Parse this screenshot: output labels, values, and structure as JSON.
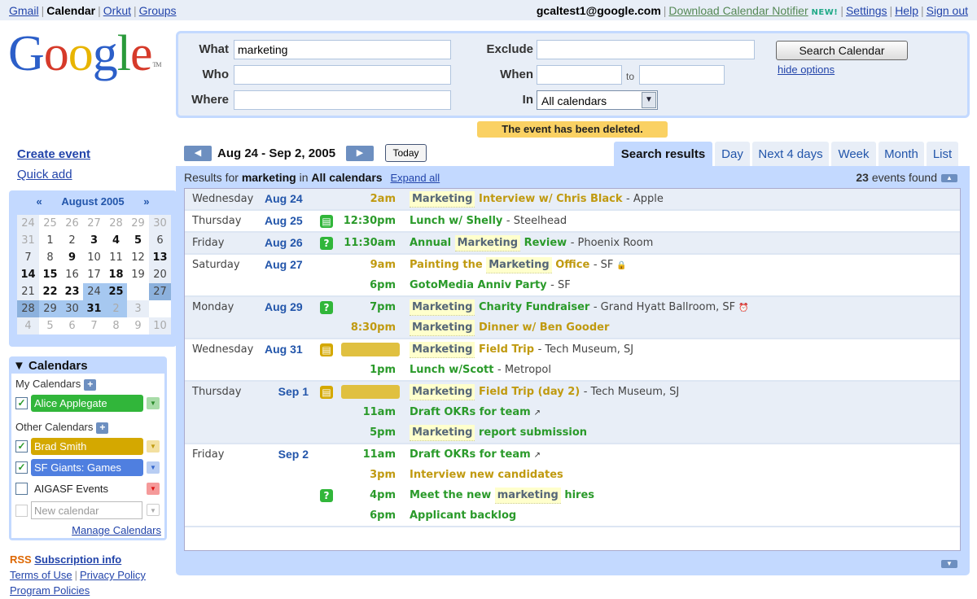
{
  "topbar": {
    "left_links": [
      "Gmail",
      "Calendar",
      "Orkut",
      "Groups"
    ],
    "active": "Calendar",
    "email": "gcaltest1@google.com",
    "notifier": "Download Calendar Notifier",
    "new_badge": "NEW!",
    "settings": "Settings",
    "help": "Help",
    "signout": "Sign out"
  },
  "logo": {
    "text": "Google",
    "tm": "TM"
  },
  "search": {
    "what_label": "What",
    "what_value": "marketing",
    "who_label": "Who",
    "who_value": "",
    "where_label": "Where",
    "where_value": "",
    "exclude_label": "Exclude",
    "exclude_value": "",
    "when_label": "When",
    "when_from": "",
    "to_label": "to",
    "when_to": "",
    "in_label": "In",
    "in_value": "All calendars",
    "search_button": "Search Calendar",
    "hide_options": "hide options"
  },
  "message": "The event has been deleted.",
  "left": {
    "create_event": "Create event",
    "quick_add": "Quick add",
    "mini_cal": {
      "prev": "«",
      "next": "»",
      "month": "August 2005"
    },
    "calendars_title": "Calendars",
    "my_calendars": "My Calendars",
    "other_calendars": "Other Calendars",
    "calendars": [
      {
        "name": "Alice Applegate",
        "checked": true,
        "color": "#31b63a",
        "dd_color": "#a8dca8"
      },
      {
        "name": "Brad Smith",
        "checked": true,
        "color": "#d4a800",
        "dd_color": "#f3e0a0"
      },
      {
        "name": "SF Giants: Games",
        "checked": true,
        "color": "#4f7fe0",
        "dd_color": "#b8cdf3"
      },
      {
        "name": "AIGASF Events",
        "checked": false,
        "color": "",
        "dd_color": "#e44"
      }
    ],
    "new_calendar_placeholder": "New calendar",
    "manage": "Manage Calendars",
    "rss": "RSS",
    "subscription": "Subscription info",
    "terms": "Terms of Use",
    "privacy": "Privacy Policy",
    "policies": "Program Policies"
  },
  "nav": {
    "range": "Aug 24 - Sep 2, 2005",
    "today": "Today",
    "tabs": [
      "Search results",
      "Day",
      "Next 4 days",
      "Week",
      "Month",
      "List"
    ],
    "active_tab": "Search results"
  },
  "results": {
    "prefix": "Results for",
    "query": "marketing",
    "in": "in",
    "scope": "All calendars",
    "expand_all": "Expand all",
    "count": "23",
    "count_suffix": "events found"
  }
}
